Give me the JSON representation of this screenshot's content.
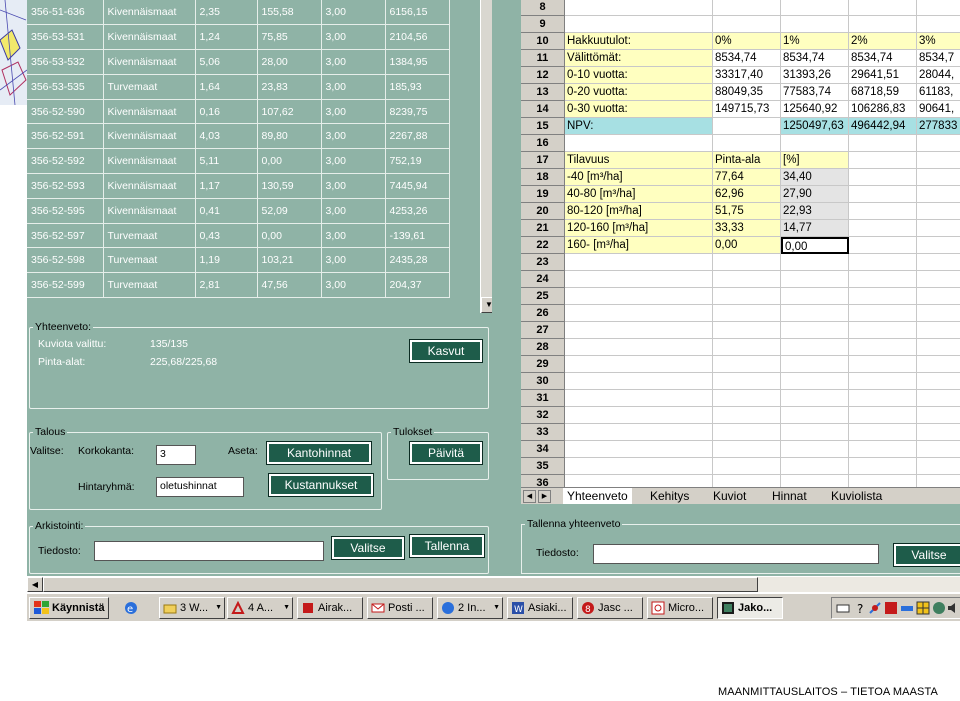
{
  "parcels": {
    "rows": [
      [
        "356-51-636",
        "Kivennäismaat",
        "2,35",
        "155,58",
        "3,00",
        "6156,15"
      ],
      [
        "356-53-531",
        "Kivennäismaat",
        "1,24",
        "75,85",
        "3,00",
        "2104,56"
      ],
      [
        "356-53-532",
        "Kivennäismaat",
        "5,06",
        "28,00",
        "3,00",
        "1384,95"
      ],
      [
        "356-53-535",
        "Turvemaat",
        "1,64",
        "23,83",
        "3,00",
        "185,93"
      ],
      [
        "356-52-590",
        "Kivennäismaat",
        "0,16",
        "107,62",
        "3,00",
        "8239,75"
      ],
      [
        "356-52-591",
        "Kivennäismaat",
        "4,03",
        "89,80",
        "3,00",
        "2267,88"
      ],
      [
        "356-52-592",
        "Kivennäismaat",
        "5,11",
        "0,00",
        "3,00",
        "752,19"
      ],
      [
        "356-52-593",
        "Kivennäismaat",
        "1,17",
        "130,59",
        "3,00",
        "7445,94"
      ],
      [
        "356-52-595",
        "Kivennäismaat",
        "0,41",
        "52,09",
        "3,00",
        "4253,26"
      ],
      [
        "356-52-597",
        "Turvemaat",
        "0,43",
        "0,00",
        "3,00",
        "-139,61"
      ],
      [
        "356-52-598",
        "Turvemaat",
        "1,19",
        "103,21",
        "3,00",
        "2435,28"
      ],
      [
        "356-52-599",
        "Turvemaat",
        "2,81",
        "47,56",
        "3,00",
        "204,37"
      ]
    ]
  },
  "yhteenveto": {
    "title": "Yhteenveto:",
    "kuviota_label": "Kuviota valittu:",
    "kuviota_value": "135/135",
    "pinta_label": "Pinta-alat:",
    "pinta_value": "225,68/225,68",
    "kasvut_button": "Kasvut"
  },
  "talous": {
    "title": "Talous",
    "valitse_label": "Valitse:",
    "korkokanta_label": "Korkokanta:",
    "korkokanta_value": "3",
    "aseta_label": "Aseta:",
    "kantohinnat_button": "Kantohinnat",
    "hintaryhma_label": "Hintaryhmä:",
    "hintaryhma_value": "oletushinnat",
    "kustannukset_button": "Kustannukset"
  },
  "tulokset": {
    "title": "Tulokset",
    "paivita_button": "Päivitä"
  },
  "arkistointi": {
    "title": "Arkistointi:",
    "tiedosto_label": "Tiedosto:",
    "tiedosto_value": "",
    "valitse_button": "Valitse",
    "tallenna_button": "Tallenna"
  },
  "sheet": {
    "row_numbers": [
      "8",
      "9",
      "10",
      "11",
      "12",
      "13",
      "14",
      "15",
      "16",
      "17",
      "18",
      "19",
      "20",
      "21",
      "22",
      "23",
      "24",
      "25",
      "26",
      "27",
      "28",
      "29",
      "30",
      "31",
      "32",
      "33",
      "34",
      "35",
      "36"
    ],
    "r10": [
      "Hakkuutulot:",
      "0%",
      "1%",
      "2%",
      "3%"
    ],
    "r11": [
      "Välittömät:",
      "8534,74",
      "8534,74",
      "8534,74",
      "8534,7"
    ],
    "r12": [
      "0-10 vuotta:",
      "33317,40",
      "31393,26",
      "29641,51",
      "28044,"
    ],
    "r13": [
      "0-20 vuotta:",
      "88049,35",
      "77583,74",
      "68718,59",
      "61183,"
    ],
    "r14": [
      "0-30 vuotta:",
      "149715,73",
      "125640,92",
      "106286,83",
      "90641,"
    ],
    "r15": [
      "NPV:",
      "",
      "1250497,63",
      "496442,94",
      "277833"
    ],
    "r17": [
      "Tilavuus",
      "Pinta-ala",
      "[%]"
    ],
    "r18": [
      "   -40  [m³/ha]",
      "77,64",
      "34,40"
    ],
    "r19": [
      " 40-80  [m³/ha]",
      "62,96",
      "27,90"
    ],
    "r20": [
      " 80-120 [m³/ha]",
      "51,75",
      "22,93"
    ],
    "r21": [
      "120-160 [m³/ha]",
      "33,33",
      "14,77"
    ],
    "r22": [
      "160-    [m³/ha]",
      "0,00",
      "0,00"
    ],
    "tabs": [
      "Yhteenveto",
      "Kehitys",
      "Kuviot",
      "Hinnat",
      "Kuviolista"
    ]
  },
  "tallenna_yhteenveto": {
    "title": "Tallenna yhteenveto",
    "tiedosto_label": "Tiedosto:",
    "tiedosto_value": "",
    "valitse_button": "Valitse"
  },
  "taskbar": {
    "start": "Käynnistä",
    "items": [
      "3 W...",
      "4 A...",
      "Airak...",
      "Posti ...",
      "2 In...",
      "Asiaki...",
      "Jasc ...",
      "Micro...",
      "Jako..."
    ]
  },
  "footer": "MAANMITTAUSLAITOS – TIETOA MAASTA",
  "colors": {
    "app_bg": "#8fb3a6",
    "button_bg": "#1e5c4a",
    "cell_yellow": "#ffffc0",
    "cell_teal": "#a7e0e3"
  }
}
